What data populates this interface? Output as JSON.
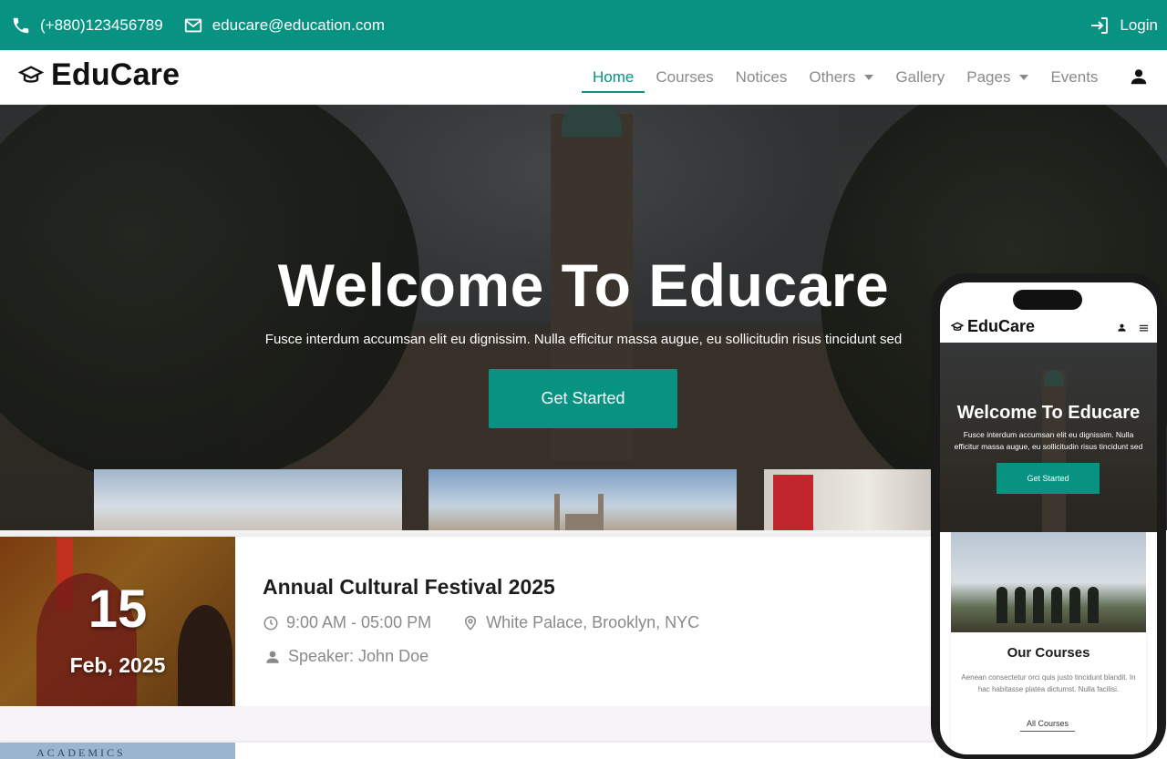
{
  "topbar": {
    "phone": "(+880)123456789",
    "email": "educare@education.com",
    "login": "Login"
  },
  "nav": {
    "brand": "EduCare",
    "links": [
      {
        "label": "Home",
        "active": true
      },
      {
        "label": "Courses"
      },
      {
        "label": "Notices"
      },
      {
        "label": "Others",
        "dropdown": true
      },
      {
        "label": "Gallery"
      },
      {
        "label": "Pages",
        "dropdown": true
      },
      {
        "label": "Events"
      }
    ]
  },
  "hero": {
    "title": "Welcome To Educare",
    "subtitle": "Fusce interdum accumsan elit eu dignissim. Nulla efficitur massa augue, eu sollicitudin risus tincidunt sed",
    "cta": "Get Started"
  },
  "event": {
    "day": "15",
    "month_year": "Feb, 2025",
    "title": "Annual Cultural Festival 2025",
    "time": "9:00 AM - 05:00 PM",
    "location": "White Palace, Brooklyn, NYC",
    "speaker": "Speaker: John Doe"
  },
  "next_event": {
    "image_text": "ACADEMICS"
  },
  "mobile": {
    "brand": "EduCare",
    "hero_title": "Welcome To Educare",
    "hero_subtitle": "Fusce interdum accumsan elit eu dignissim. Nulla efficitur massa augue, eu sollicitudin risus tincidunt sed",
    "cta": "Get Started",
    "section_title": "Our Courses",
    "section_text": "Aenean consectetur orci quis justo tincidunt blandit. In hac habitasse platea dictumst. Nulla facilisi.",
    "section_link": "All Courses"
  },
  "colors": {
    "accent": "#079282"
  }
}
